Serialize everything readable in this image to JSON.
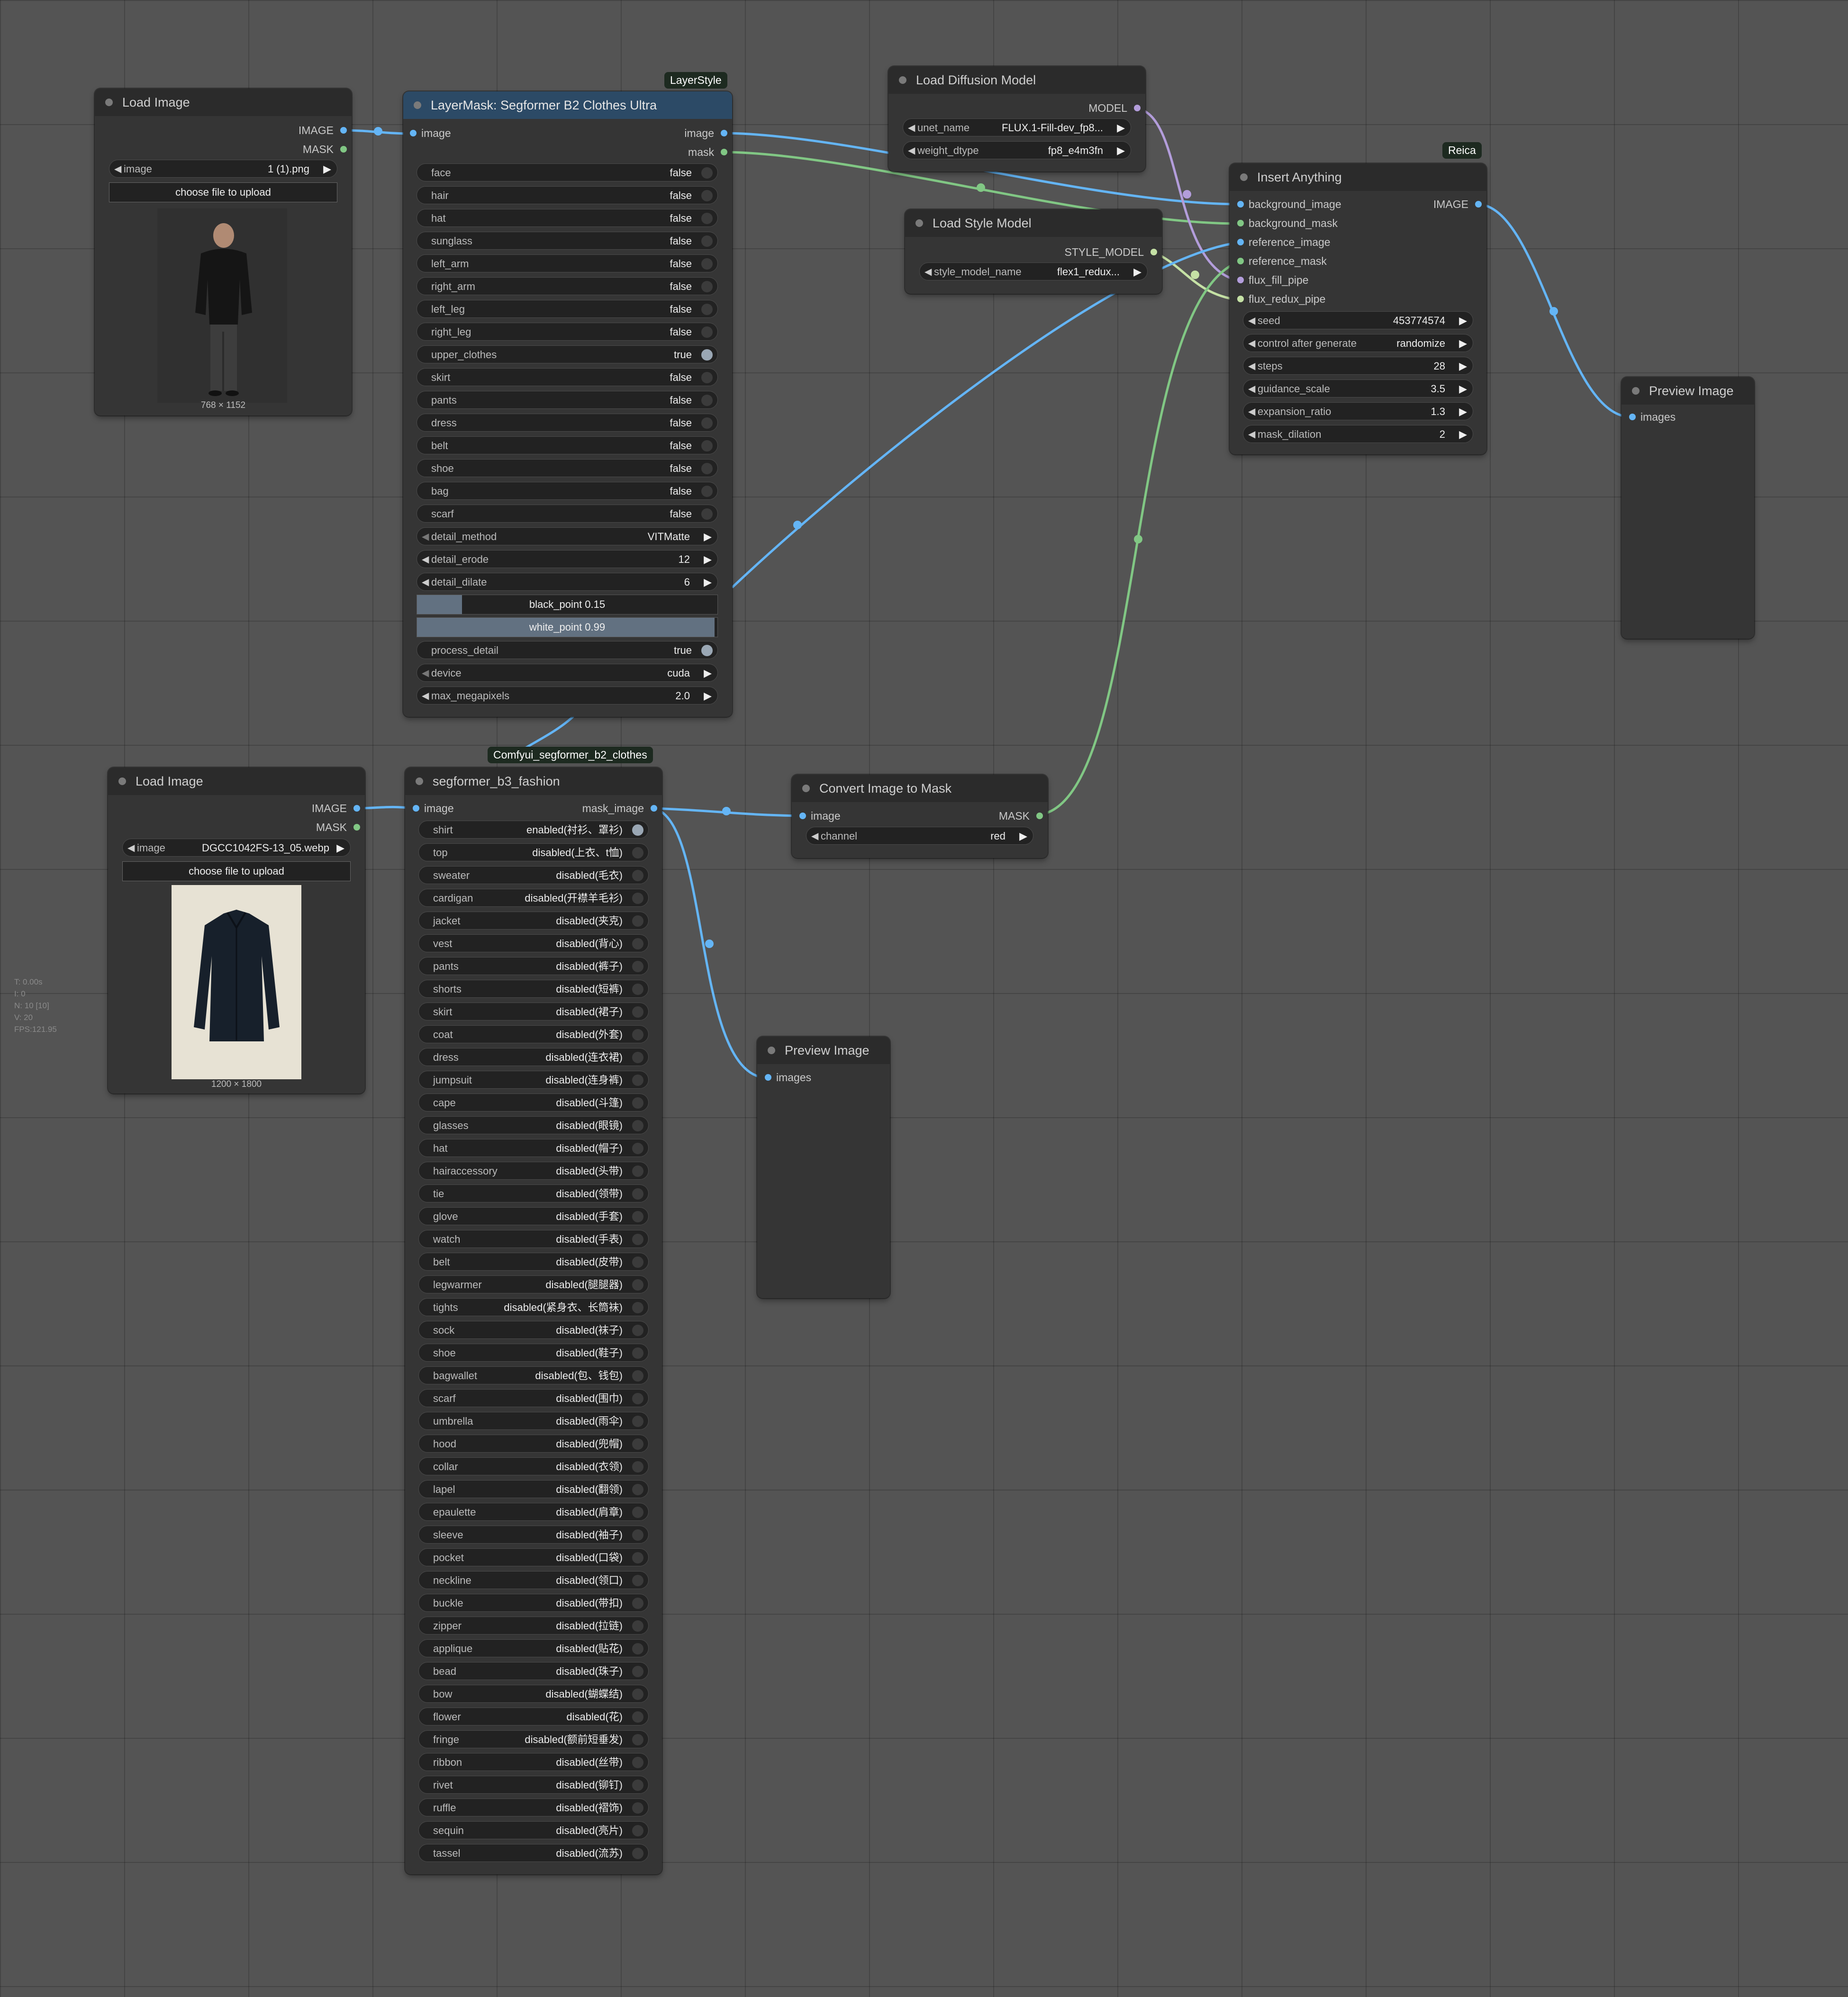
{
  "load_image_1": {
    "title": "Load Image",
    "outputs": [
      "IMAGE",
      "MASK"
    ],
    "image_label": "image",
    "image_value": "1 (1).png",
    "upload_label": "choose file to upload",
    "size_caption": "768 × 1152"
  },
  "layermask": {
    "badge": "LayerStyle",
    "title": "LayerMask: Segformer B2 Clothes Ultra",
    "input": "image",
    "outputs": [
      "image",
      "mask"
    ],
    "toggles": [
      {
        "label": "face",
        "value": "false"
      },
      {
        "label": "hair",
        "value": "false"
      },
      {
        "label": "hat",
        "value": "false"
      },
      {
        "label": "sunglass",
        "value": "false"
      },
      {
        "label": "left_arm",
        "value": "false"
      },
      {
        "label": "right_arm",
        "value": "false"
      },
      {
        "label": "left_leg",
        "value": "false"
      },
      {
        "label": "right_leg",
        "value": "false"
      },
      {
        "label": "upper_clothes",
        "value": "true"
      },
      {
        "label": "skirt",
        "value": "false"
      },
      {
        "label": "pants",
        "value": "false"
      },
      {
        "label": "dress",
        "value": "false"
      },
      {
        "label": "belt",
        "value": "false"
      },
      {
        "label": "shoe",
        "value": "false"
      },
      {
        "label": "bag",
        "value": "false"
      },
      {
        "label": "scarf",
        "value": "false"
      }
    ],
    "combos": [
      {
        "label": "detail_method",
        "value": "VITMatte"
      },
      {
        "label": "detail_erode",
        "value": "12"
      },
      {
        "label": "detail_dilate",
        "value": "6"
      }
    ],
    "black_point": {
      "text": "black_point  0.15",
      "fill": 0.15
    },
    "white_point": {
      "text": "white_point  0.99",
      "fill": 0.99
    },
    "process_detail": {
      "label": "process_detail",
      "value": "true"
    },
    "device": {
      "label": "device",
      "value": "cuda"
    },
    "max_megapixels": {
      "label": "max_megapixels",
      "value": "2.0"
    }
  },
  "load_diffusion": {
    "title": "Load Diffusion Model",
    "output": "MODEL",
    "widgets": [
      {
        "label": "unet_name",
        "value": "FLUX.1-Fill-dev_fp8..."
      },
      {
        "label": "weight_dtype",
        "value": "fp8_e4m3fn"
      }
    ]
  },
  "load_style": {
    "title": "Load Style Model",
    "output": "STYLE_MODEL",
    "widgets": [
      {
        "label": "style_model_name",
        "value": "flex1_redux..."
      }
    ]
  },
  "insert_anything": {
    "badge": "Reica",
    "title": "Insert Anything",
    "inputs": [
      "background_image",
      "background_mask",
      "reference_image",
      "reference_mask",
      "flux_fill_pipe",
      "flux_redux_pipe"
    ],
    "output": "IMAGE",
    "widgets": [
      {
        "label": "seed",
        "value": "453774574"
      },
      {
        "label": "control after generate",
        "value": "randomize"
      },
      {
        "label": "steps",
        "value": "28"
      },
      {
        "label": "guidance_scale",
        "value": "3.5"
      },
      {
        "label": "expansion_ratio",
        "value": "1.3"
      },
      {
        "label": "mask_dilation",
        "value": "2"
      }
    ]
  },
  "preview_1": {
    "title": "Preview Image",
    "input": "images"
  },
  "load_image_2": {
    "title": "Load Image",
    "outputs": [
      "IMAGE",
      "MASK"
    ],
    "image_label": "image",
    "image_value": "DGCC1042FS-13_05.webp",
    "upload_label": "choose file to upload",
    "size_caption": "1200 × 1800"
  },
  "segformer_b3": {
    "badge": "Comfyui_segformer_b2_clothes",
    "title": "segformer_b3_fashion",
    "input": "image",
    "output": "mask_image",
    "toggles": [
      {
        "label": "shirt",
        "value": "enabled(衬衫、罩衫)"
      },
      {
        "label": "top",
        "value": "disabled(上衣、t恤)"
      },
      {
        "label": "sweater",
        "value": "disabled(毛衣)"
      },
      {
        "label": "cardigan",
        "value": "disabled(开襟羊毛衫)"
      },
      {
        "label": "jacket",
        "value": "disabled(夹克)"
      },
      {
        "label": "vest",
        "value": "disabled(背心)"
      },
      {
        "label": "pants",
        "value": "disabled(裤子)"
      },
      {
        "label": "shorts",
        "value": "disabled(短裤)"
      },
      {
        "label": "skirt",
        "value": "disabled(裙子)"
      },
      {
        "label": "coat",
        "value": "disabled(外套)"
      },
      {
        "label": "dress",
        "value": "disabled(连衣裙)"
      },
      {
        "label": "jumpsuit",
        "value": "disabled(连身裤)"
      },
      {
        "label": "cape",
        "value": "disabled(斗篷)"
      },
      {
        "label": "glasses",
        "value": "disabled(眼镜)"
      },
      {
        "label": "hat",
        "value": "disabled(帽子)"
      },
      {
        "label": "hairaccessory",
        "value": "disabled(头带)"
      },
      {
        "label": "tie",
        "value": "disabled(领带)"
      },
      {
        "label": "glove",
        "value": "disabled(手套)"
      },
      {
        "label": "watch",
        "value": "disabled(手表)"
      },
      {
        "label": "belt",
        "value": "disabled(皮带)"
      },
      {
        "label": "legwarmer",
        "value": "disabled(腿腿器)"
      },
      {
        "label": "tights",
        "value": "disabled(紧身衣、长筒袜)"
      },
      {
        "label": "sock",
        "value": "disabled(袜子)"
      },
      {
        "label": "shoe",
        "value": "disabled(鞋子)"
      },
      {
        "label": "bagwallet",
        "value": "disabled(包、钱包)"
      },
      {
        "label": "scarf",
        "value": "disabled(围巾)"
      },
      {
        "label": "umbrella",
        "value": "disabled(雨伞)"
      },
      {
        "label": "hood",
        "value": "disabled(兜帽)"
      },
      {
        "label": "collar",
        "value": "disabled(衣领)"
      },
      {
        "label": "lapel",
        "value": "disabled(翻领)"
      },
      {
        "label": "epaulette",
        "value": "disabled(肩章)"
      },
      {
        "label": "sleeve",
        "value": "disabled(袖子)"
      },
      {
        "label": "pocket",
        "value": "disabled(口袋)"
      },
      {
        "label": "neckline",
        "value": "disabled(领口)"
      },
      {
        "label": "buckle",
        "value": "disabled(带扣)"
      },
      {
        "label": "zipper",
        "value": "disabled(拉链)"
      },
      {
        "label": "applique",
        "value": "disabled(贴花)"
      },
      {
        "label": "bead",
        "value": "disabled(珠子)"
      },
      {
        "label": "bow",
        "value": "disabled(蝴蝶结)"
      },
      {
        "label": "flower",
        "value": "disabled(花)"
      },
      {
        "label": "fringe",
        "value": "disabled(额前短垂发)"
      },
      {
        "label": "ribbon",
        "value": "disabled(丝带)"
      },
      {
        "label": "rivet",
        "value": "disabled(铆钉)"
      },
      {
        "label": "ruffle",
        "value": "disabled(褶饰)"
      },
      {
        "label": "sequin",
        "value": "disabled(亮片)"
      },
      {
        "label": "tassel",
        "value": "disabled(流苏)"
      }
    ]
  },
  "convert_mask": {
    "title": "Convert Image to Mask",
    "input": "image",
    "output": "MASK",
    "widget": {
      "label": "channel",
      "value": "red"
    }
  },
  "preview_2": {
    "title": "Preview Image",
    "input": "images"
  },
  "stats": [
    "T: 0.00s",
    "I: 0",
    "N: 10 [10]",
    "V: 20",
    "FPS:121.95"
  ],
  "colors": {
    "image_link": "#64b5f6",
    "mask_link": "#81c784",
    "model_link": "#b39ddb",
    "style_link": "#c5e1a5",
    "background": "#545454",
    "node": "#353535"
  }
}
